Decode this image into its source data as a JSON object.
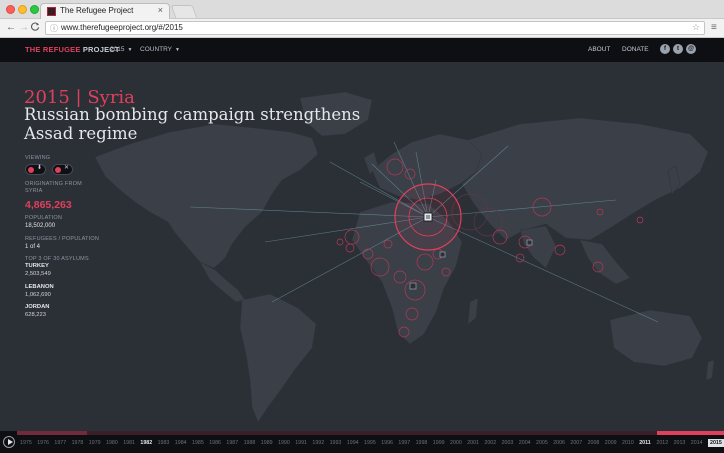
{
  "browser": {
    "tab_title": "The Refugee Project",
    "tab_close": "×",
    "url": "www.therefugeeproject.org/#/2015",
    "nav_back": "←",
    "nav_forward": "→",
    "nav_reload": "C",
    "menu": "≡",
    "star": "☆",
    "secure_icon": "ⓘ"
  },
  "header": {
    "logo_part1": "THE REFUGEE",
    "logo_part2": "PROJECT",
    "year_dropdown": "2015",
    "country_dropdown": "COUNTRY",
    "about": "ABOUT",
    "donate": "DONATE",
    "social": [
      {
        "icon": "facebook-icon",
        "glyph": "f"
      },
      {
        "icon": "twitter-icon",
        "glyph": "t"
      },
      {
        "icon": "mail-icon",
        "glyph": "@"
      }
    ]
  },
  "story": {
    "year_country": "2015 | Syria",
    "headline": "Russian bombing campaign strengthens Assad regime"
  },
  "sidebar": {
    "viewing_label": "VIEWING",
    "viewing_chip1_symbol": "⬇",
    "viewing_chip2_symbol": "✕",
    "originating_label_1": "ORIGINATING FROM",
    "originating_label_2": "SYRIA",
    "originating_value": "4,865,263",
    "population_label": "POPULATION",
    "population_value": "18,502,000",
    "ratio_label": "REFUGEES / POPULATION",
    "ratio_value": "1 of 4",
    "asylums_label": "TOP 3 OF 30 ASYLUMS",
    "asylums": [
      {
        "name": "TURKEY",
        "count": "2,503,549"
      },
      {
        "name": "LEBANON",
        "count": "1,062,690"
      },
      {
        "name": "JORDAN",
        "count": "628,223"
      }
    ]
  },
  "timeline": {
    "play_icon": "play-icon",
    "years": [
      "1975",
      "1976",
      "1977",
      "1978",
      "1979",
      "1980",
      "1981",
      "1982",
      "1983",
      "1984",
      "1985",
      "1986",
      "1987",
      "1988",
      "1989",
      "1990",
      "1991",
      "1992",
      "1993",
      "1994",
      "1995",
      "1996",
      "1997",
      "1998",
      "1999",
      "2000",
      "2001",
      "2002",
      "2003",
      "2004",
      "2005",
      "2006",
      "2007",
      "2008",
      "2009",
      "2010",
      "2011",
      "2012",
      "2013",
      "2014",
      "2015"
    ],
    "bold_years": [
      "1982",
      "2011"
    ],
    "active_year": "2015"
  },
  "colors": {
    "accent": "#e0405c",
    "background": "#2b2f36",
    "land": "#3a3f48",
    "header": "#0e0f12"
  }
}
